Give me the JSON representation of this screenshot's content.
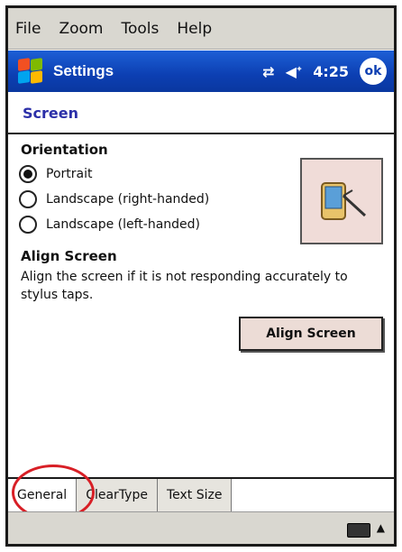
{
  "menubar": {
    "items": [
      "File",
      "Zoom",
      "Tools",
      "Help"
    ]
  },
  "titlebar": {
    "title": "Settings",
    "time": "4:25",
    "ok_label": "ok"
  },
  "heading": "Screen",
  "orientation": {
    "title": "Orientation",
    "options": [
      "Portrait",
      "Landscape (right-handed)",
      "Landscape (left-handed)"
    ],
    "selected": "Portrait"
  },
  "align": {
    "title": "Align Screen",
    "description": "Align the screen if it is not responding accurately to stylus taps.",
    "button_label": "Align Screen"
  },
  "tabs": [
    "General",
    "ClearType",
    "Text Size"
  ],
  "colors": {
    "title_bar": "#0c3fb2",
    "heading": "#2b2fa8",
    "annotation_circle": "#d81f26"
  }
}
